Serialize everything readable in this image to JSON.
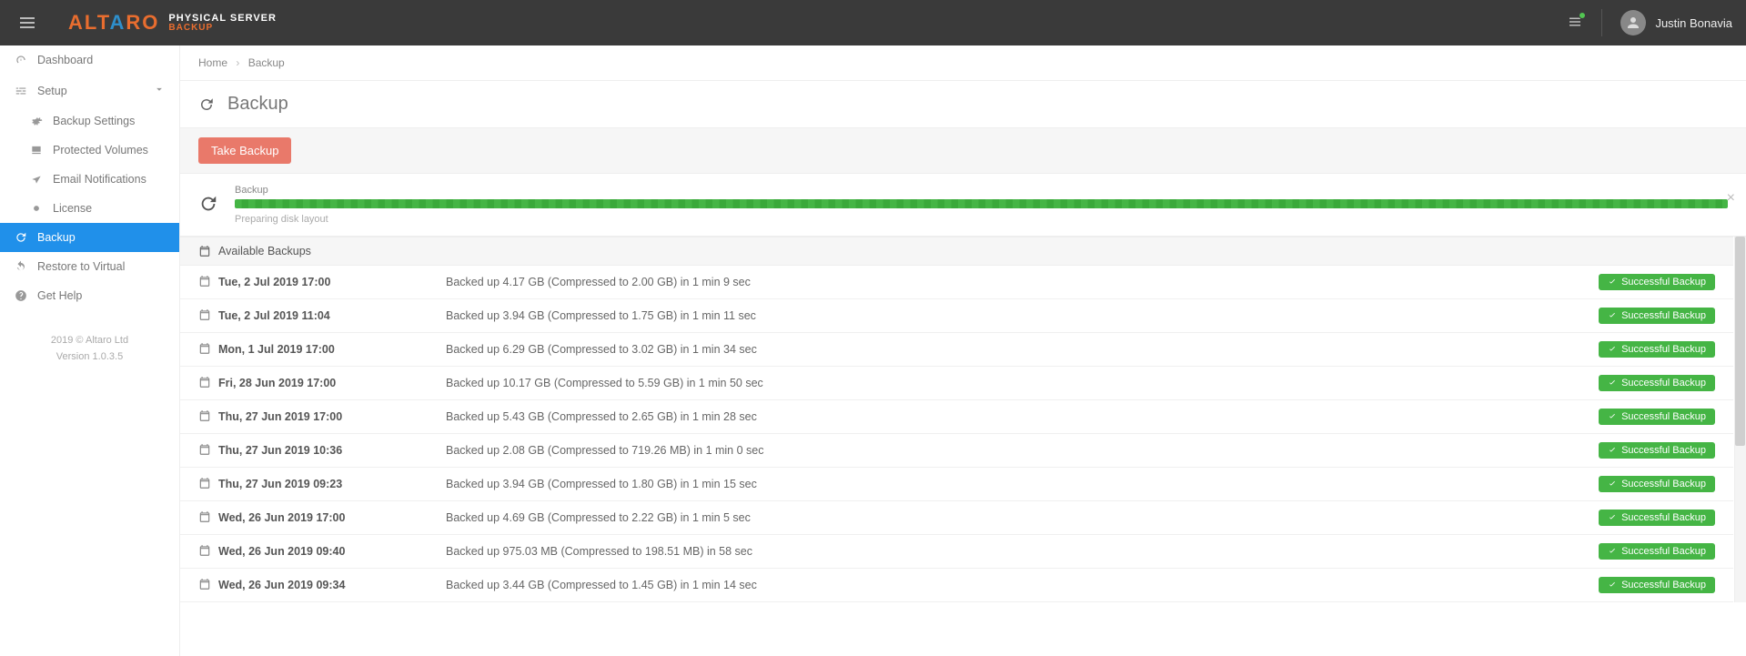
{
  "brand": {
    "logo": "ALTARO",
    "line1": "PHYSICAL SERVER",
    "line2": "BACKUP"
  },
  "user": {
    "name": "Justin Bonavia"
  },
  "nav": {
    "dashboard": "Dashboard",
    "setup": "Setup",
    "backup_settings": "Backup Settings",
    "protected_volumes": "Protected Volumes",
    "email_notifications": "Email Notifications",
    "license": "License",
    "backup": "Backup",
    "restore": "Restore to Virtual",
    "help": "Get Help"
  },
  "footer": {
    "copyright": "2019  © Altaro Ltd",
    "version": "Version 1.0.3.5"
  },
  "breadcrumb": {
    "home": "Home",
    "current": "Backup"
  },
  "page": {
    "title": "Backup",
    "take_button": "Take Backup"
  },
  "progress": {
    "label": "Backup",
    "status": "Preparing disk layout"
  },
  "section": {
    "available": "Available Backups"
  },
  "badge_text": "Successful Backup",
  "backups": [
    {
      "date": "Tue, 2 Jul 2019 17:00",
      "details": "Backed up 4.17 GB (Compressed to 2.00 GB) in 1 min 9 sec"
    },
    {
      "date": "Tue, 2 Jul 2019 11:04",
      "details": "Backed up 3.94 GB (Compressed to 1.75 GB) in 1 min 11 sec"
    },
    {
      "date": "Mon, 1 Jul 2019 17:00",
      "details": "Backed up 6.29 GB (Compressed to 3.02 GB) in 1 min 34 sec"
    },
    {
      "date": "Fri, 28 Jun 2019 17:00",
      "details": "Backed up 10.17 GB (Compressed to 5.59 GB) in 1 min 50 sec"
    },
    {
      "date": "Thu, 27 Jun 2019 17:00",
      "details": "Backed up 5.43 GB (Compressed to 2.65 GB) in 1 min 28 sec"
    },
    {
      "date": "Thu, 27 Jun 2019 10:36",
      "details": "Backed up 2.08 GB (Compressed to 719.26 MB) in 1 min 0 sec"
    },
    {
      "date": "Thu, 27 Jun 2019 09:23",
      "details": "Backed up 3.94 GB (Compressed to 1.80 GB) in 1 min 15 sec"
    },
    {
      "date": "Wed, 26 Jun 2019 17:00",
      "details": "Backed up 4.69 GB (Compressed to 2.22 GB) in 1 min 5 sec"
    },
    {
      "date": "Wed, 26 Jun 2019 09:40",
      "details": "Backed up 975.03 MB (Compressed to 198.51 MB) in 58 sec"
    },
    {
      "date": "Wed, 26 Jun 2019 09:34",
      "details": "Backed up 3.44 GB (Compressed to 1.45 GB) in 1 min 14 sec"
    }
  ]
}
